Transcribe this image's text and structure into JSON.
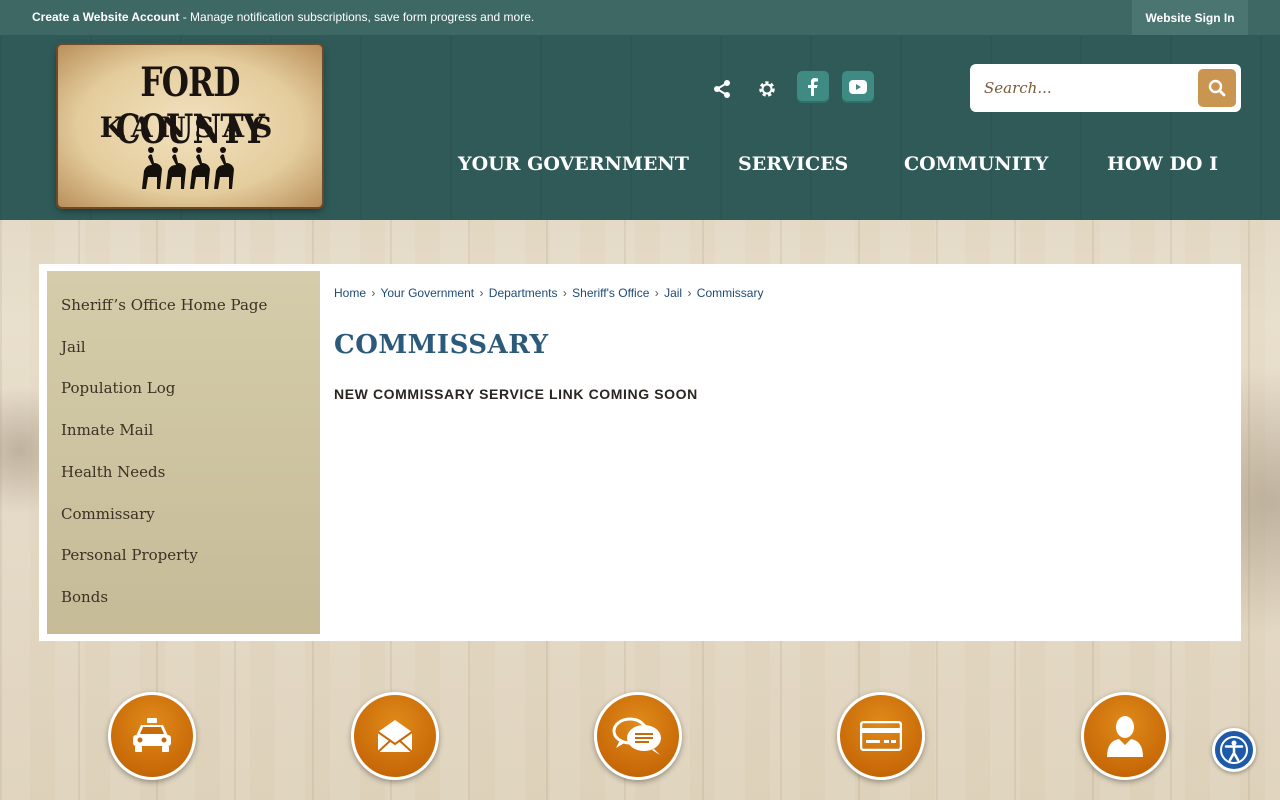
{
  "topbar": {
    "create_account_label": "Create a Website Account",
    "message": " - Manage notification subscriptions, save form progress and more.",
    "signin_label": "Website Sign In"
  },
  "logo": {
    "line1": "FORD COUNTY",
    "line2": "KANSAS"
  },
  "social": {
    "icons": [
      "share-icon",
      "gear-icon",
      "facebook-icon",
      "youtube-icon"
    ]
  },
  "search": {
    "placeholder": "Search..."
  },
  "nav": {
    "items": [
      "YOUR GOVERNMENT",
      "SERVICES",
      "COMMUNITY",
      "HOW DO I"
    ]
  },
  "sidebar": {
    "items": [
      "Sheriff’s Office Home Page",
      "Jail",
      "Population Log",
      "Inmate Mail",
      "Health Needs",
      "Commissary",
      "Personal Property",
      "Bonds"
    ]
  },
  "breadcrumb": {
    "items": [
      "Home",
      "Your Government",
      "Departments",
      "Sheriff's Office",
      "Jail",
      "Commissary"
    ],
    "separator": "›"
  },
  "page": {
    "title": "COMMISSARY",
    "notice": "NEW COMMISSARY SERVICE LINK COMING SOON"
  },
  "quick_links": {
    "icons": [
      "police-car-icon",
      "mail-envelope-icon",
      "chat-bubbles-icon",
      "credit-card-icon",
      "person-icon"
    ]
  },
  "accessibility": {
    "icon": "accessibility-icon"
  },
  "colors": {
    "topbar": "#3d6863",
    "header": "#2f5a58",
    "accent_orange": "#c86a08",
    "title_blue": "#2c5a7a",
    "sidebar_tan": "#cfc6a3"
  }
}
